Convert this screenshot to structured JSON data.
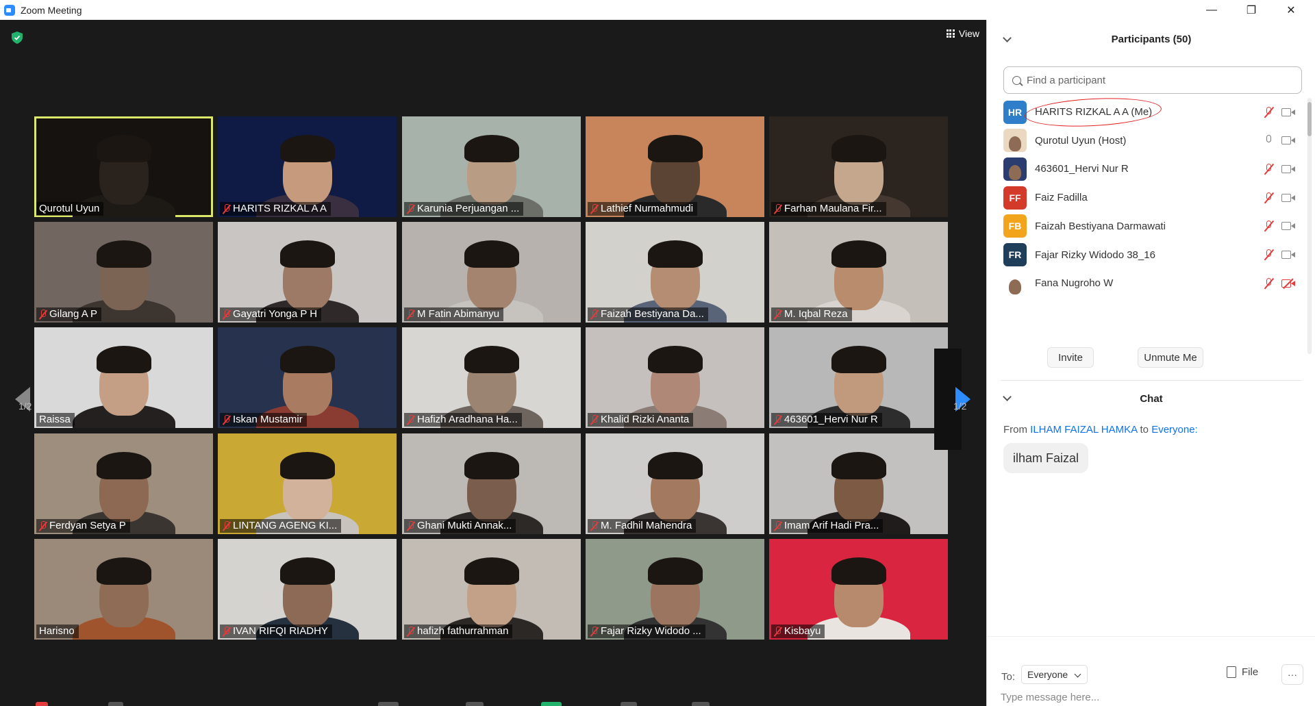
{
  "window": {
    "title": "Zoom Meeting",
    "minimize": "—",
    "maximize": "❐",
    "close": "✕"
  },
  "video": {
    "view_label": "View",
    "page_left": "1/2",
    "page_right": "1/2",
    "tiles": [
      {
        "name": "Qurotul Uyun",
        "muted": false,
        "active": true,
        "bg": "#15120f",
        "skin": "#2a221d",
        "shirt": "#1d1915"
      },
      {
        "name": "HARITS RIZKAL A A",
        "muted": true,
        "bg": "#0f1b45",
        "skin": "#c69b7d",
        "shirt": "#3a2f40"
      },
      {
        "name": "Karunia Perjuangan ...",
        "muted": true,
        "bg": "#a7b3aa",
        "skin": "#b89c84",
        "shirt": "#6c6f68"
      },
      {
        "name": "Lathief Nurmahmudi",
        "muted": true,
        "bg": "#c8855c",
        "skin": "#5c4434",
        "shirt": "#2a2a2a"
      },
      {
        "name": "Farhan Maulana Fir...",
        "muted": true,
        "bg": "#2b241f",
        "skin": "#c5a78e",
        "shirt": "#453830"
      },
      {
        "name": "Gilang A P",
        "muted": true,
        "bg": "#716760",
        "skin": "#7b6453",
        "shirt": "#3d3530"
      },
      {
        "name": "Gayatri Yonga P H",
        "muted": true,
        "bg": "#c9c5c3",
        "skin": "#9c7a66",
        "shirt": "#2f2a29"
      },
      {
        "name": "M Fatin Abimanyu",
        "muted": true,
        "bg": "#b7b2ad",
        "skin": "#a4836f",
        "shirt": "#c6c2bd"
      },
      {
        "name": "Faizah Bestiyana Da...",
        "muted": true,
        "bg": "#d3d1cc",
        "skin": "#b48d72",
        "shirt": "#5a6478"
      },
      {
        "name": "M. Iqbal Reza",
        "muted": true,
        "bg": "#c4bfb9",
        "skin": "#b88c6d",
        "shirt": "#d9d4cf"
      },
      {
        "name": "Raissa",
        "muted": false,
        "bg": "#d9d9d9",
        "skin": "#c49f86",
        "shirt": "#24201f"
      },
      {
        "name": "Iskan Mustamir",
        "muted": true,
        "bg": "#26324e",
        "skin": "#a97b61",
        "shirt": "#8a3b32"
      },
      {
        "name": "Hafizh Aradhana Ha...",
        "muted": true,
        "bg": "#d8d6d2",
        "skin": "#9b8472",
        "shirt": "#6d655e"
      },
      {
        "name": "Khalid Rizki Ananta",
        "muted": true,
        "bg": "#c5c0bd",
        "skin": "#b08877",
        "shirt": "#8b7d76"
      },
      {
        "name": "463601_Hervi Nur R",
        "muted": true,
        "bg": "#b8b8b8",
        "skin": "#c1997c",
        "shirt": "#2d2d2d"
      },
      {
        "name": "Ferdyan Setya P",
        "muted": true,
        "bg": "#9e8e7e",
        "skin": "#8d6953",
        "shirt": "#3a3530"
      },
      {
        "name": "LINTANG AGENG KI...",
        "muted": true,
        "bg": "#c9a833",
        "skin": "#d2b29a",
        "shirt": "#c8c4bd"
      },
      {
        "name": "Ghani Mukti Annak...",
        "muted": true,
        "bg": "#bdb9b5",
        "skin": "#7a5d4c",
        "shirt": "#2d2926"
      },
      {
        "name": "M. Fadhil Mahendra",
        "muted": true,
        "bg": "#cfcdcb",
        "skin": "#a37a5f",
        "shirt": "#3a3432"
      },
      {
        "name": "Imam Arif Hadi Pra...",
        "muted": true,
        "bg": "#c3c1bf",
        "skin": "#7c5a44",
        "shirt": "#1f1c1b"
      },
      {
        "name": "Harisno",
        "muted": false,
        "bg": "#9b8a7a",
        "skin": "#8f6c55",
        "shirt": "#a0542e"
      },
      {
        "name": "IVAN RIFQI RIADHY",
        "muted": true,
        "bg": "#d5d3d0",
        "skin": "#8c6a55",
        "shirt": "#26313f"
      },
      {
        "name": "hafizh fathurrahman",
        "muted": true,
        "bg": "#c2bcb4",
        "skin": "#c3a088",
        "shirt": "#2b2826"
      },
      {
        "name": "Fajar Rizky Widodo ...",
        "muted": true,
        "bg": "#8f9a8a",
        "skin": "#9c7560",
        "shirt": "#333"
      },
      {
        "name": "Kisbayu",
        "muted": true,
        "bg": "#d9253f",
        "skin": "#b88a6d",
        "shirt": "#e9e4e0"
      }
    ]
  },
  "participants": {
    "title": "Participants (50)",
    "search_placeholder": "Find a participant",
    "items": [
      {
        "initials": "HR",
        "color": "#2e7ec9",
        "name": "HARITS RIZKAL A A (Me)",
        "mic": "muted",
        "cam": "on"
      },
      {
        "initials": "",
        "color": "#ead9c0",
        "name": "Qurotul Uyun (Host)",
        "mic": "on",
        "cam": "on"
      },
      {
        "initials": "",
        "color": "#2a3d6e",
        "name": "463601_Hervi Nur R",
        "mic": "muted",
        "cam": "on"
      },
      {
        "initials": "FF",
        "color": "#d33a2a",
        "name": "Faiz Fadilla",
        "mic": "muted",
        "cam": "on"
      },
      {
        "initials": "FB",
        "color": "#f2a51c",
        "name": "Faizah Bestiyana Darmawati",
        "mic": "muted",
        "cam": "on"
      },
      {
        "initials": "FR",
        "color": "#1f3e5a",
        "name": "Fajar Rizky Widodo 38_16",
        "mic": "muted",
        "cam": "on"
      },
      {
        "initials": "",
        "color": "#ffffff",
        "name": "Fana Nugroho W",
        "mic": "muted",
        "cam": "off"
      }
    ],
    "invite_label": "Invite",
    "unmute_label": "Unmute Me"
  },
  "chat": {
    "title": "Chat",
    "from_prefix": "From",
    "from_name": "ILHAM FAIZAL HAMKA",
    "to_word": "to",
    "to_name": "Everyone:",
    "message": "ilham Faizal",
    "to_label": "To:",
    "to_value": "Everyone",
    "file_label": "File",
    "more_label": "···",
    "input_placeholder": "Type message here..."
  }
}
